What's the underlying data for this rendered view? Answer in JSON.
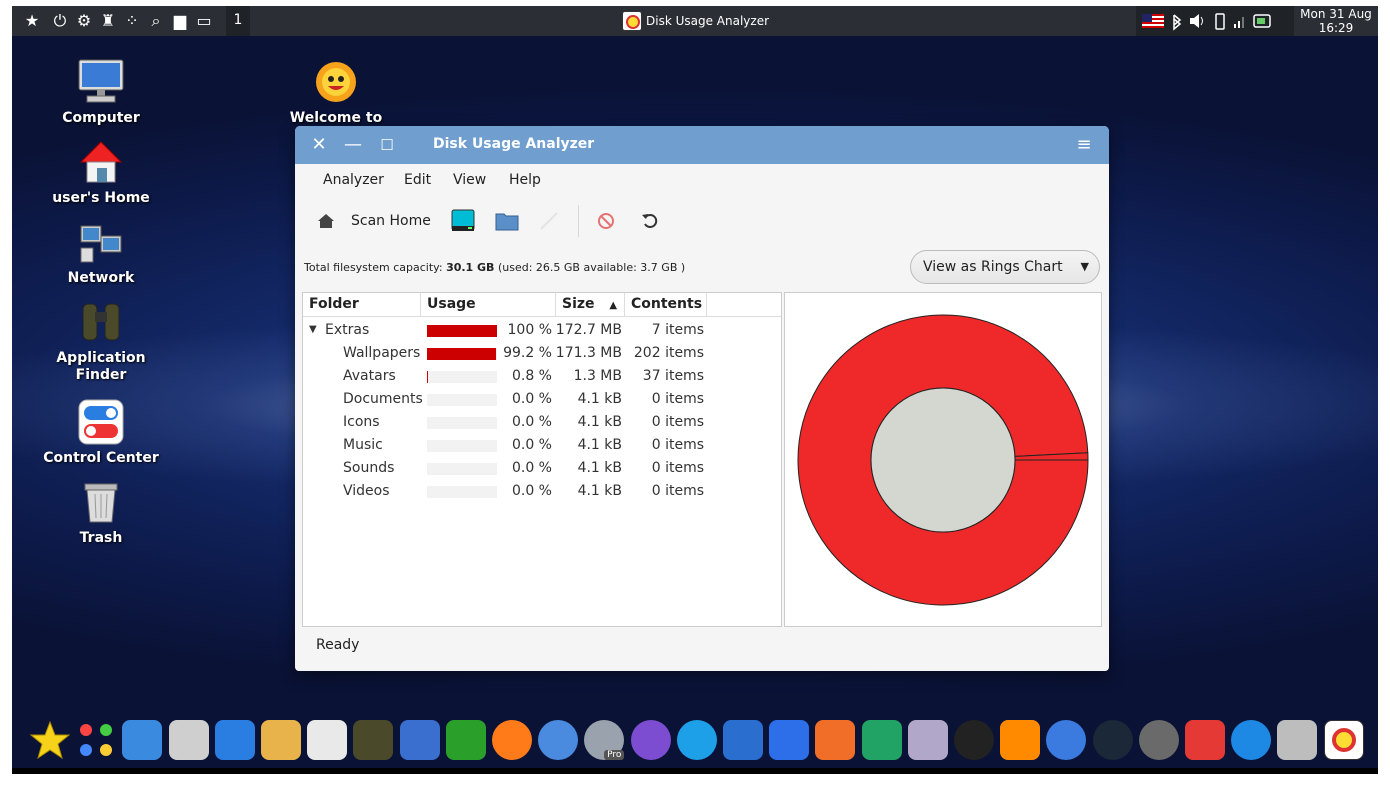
{
  "top_panel": {
    "workspace": "1",
    "task_title": "Disk Usage Analyzer",
    "clock_date": "Mon 31 Aug",
    "clock_time": "16:29"
  },
  "desktop": {
    "icons": [
      {
        "label": "Computer"
      },
      {
        "label": "user's Home"
      },
      {
        "label": "Network"
      },
      {
        "label": "Application Finder"
      },
      {
        "label": "Control Center"
      },
      {
        "label": "Trash"
      },
      {
        "label": "Welcome to"
      }
    ]
  },
  "window": {
    "title": "Disk Usage Analyzer",
    "menu": [
      "Analyzer",
      "Edit",
      "View",
      "Help"
    ],
    "toolbar": {
      "scan_home_label": "Scan Home"
    },
    "capacity": {
      "prefix": "Total filesystem capacity:",
      "total": "30.1 GB",
      "detail": "(used: 26.5 GB available: 3.7 GB )"
    },
    "view_select": {
      "value": "View as Rings Chart"
    },
    "columns": [
      "Folder",
      "Usage",
      "Size",
      "Contents"
    ],
    "sort_indicator": "▲",
    "rows": [
      {
        "name": "Extras",
        "percent": "100 %",
        "size": "172.7 MB",
        "contents": "7 items",
        "usage_fraction": 1.0,
        "expanded": true
      },
      {
        "name": "Wallpapers",
        "percent": "99.2 %",
        "size": "171.3 MB",
        "contents": "202 items",
        "usage_fraction": 0.992
      },
      {
        "name": "Avatars",
        "percent": "0.8 %",
        "size": "1.3 MB",
        "contents": "37 items",
        "usage_fraction": 0.008
      },
      {
        "name": "Documents",
        "percent": "0.0 %",
        "size": "4.1 kB",
        "contents": "0 items",
        "usage_fraction": 0
      },
      {
        "name": "Icons",
        "percent": "0.0 %",
        "size": "4.1 kB",
        "contents": "0 items",
        "usage_fraction": 0
      },
      {
        "name": "Music",
        "percent": "0.0 %",
        "size": "4.1 kB",
        "contents": "0 items",
        "usage_fraction": 0
      },
      {
        "name": "Sounds",
        "percent": "0.0 %",
        "size": "4.1 kB",
        "contents": "0 items",
        "usage_fraction": 0
      },
      {
        "name": "Videos",
        "percent": "0.0 %",
        "size": "4.1 kB",
        "contents": "0 items",
        "usage_fraction": 0
      }
    ],
    "rings": {
      "wallpapers_fraction": 0.992,
      "avatars_fraction": 0.008,
      "ring_color": "#ef2929",
      "center_color": "#d3d7cf"
    },
    "status": "Ready"
  },
  "colors": {
    "titlebar": "#6f9ecf",
    "usage_bar": "#cc0000",
    "panel": "#2b2f35"
  },
  "dock": {
    "icons": [
      "favorites-icon",
      "apps-icon",
      "window-icon",
      "files-icon",
      "settings-icon",
      "appearance-icon",
      "software-icon",
      "finder-icon",
      "launcher-icon",
      "pipe-icon",
      "firefox-icon",
      "chrome-icon",
      "earth-pro-icon",
      "viber-icon",
      "skype-icon",
      "mail-icon",
      "writer-icon",
      "presentation-icon",
      "spreadsheet-icon",
      "photo-icon",
      "amazon-icon",
      "vlc-icon",
      "qbittorrent-icon",
      "steam-icon",
      "backup-icon",
      "anydesk-icon",
      "teamviewer-icon",
      "trash-icon",
      "disk-usage-icon"
    ],
    "pro_badge": "Pro"
  }
}
